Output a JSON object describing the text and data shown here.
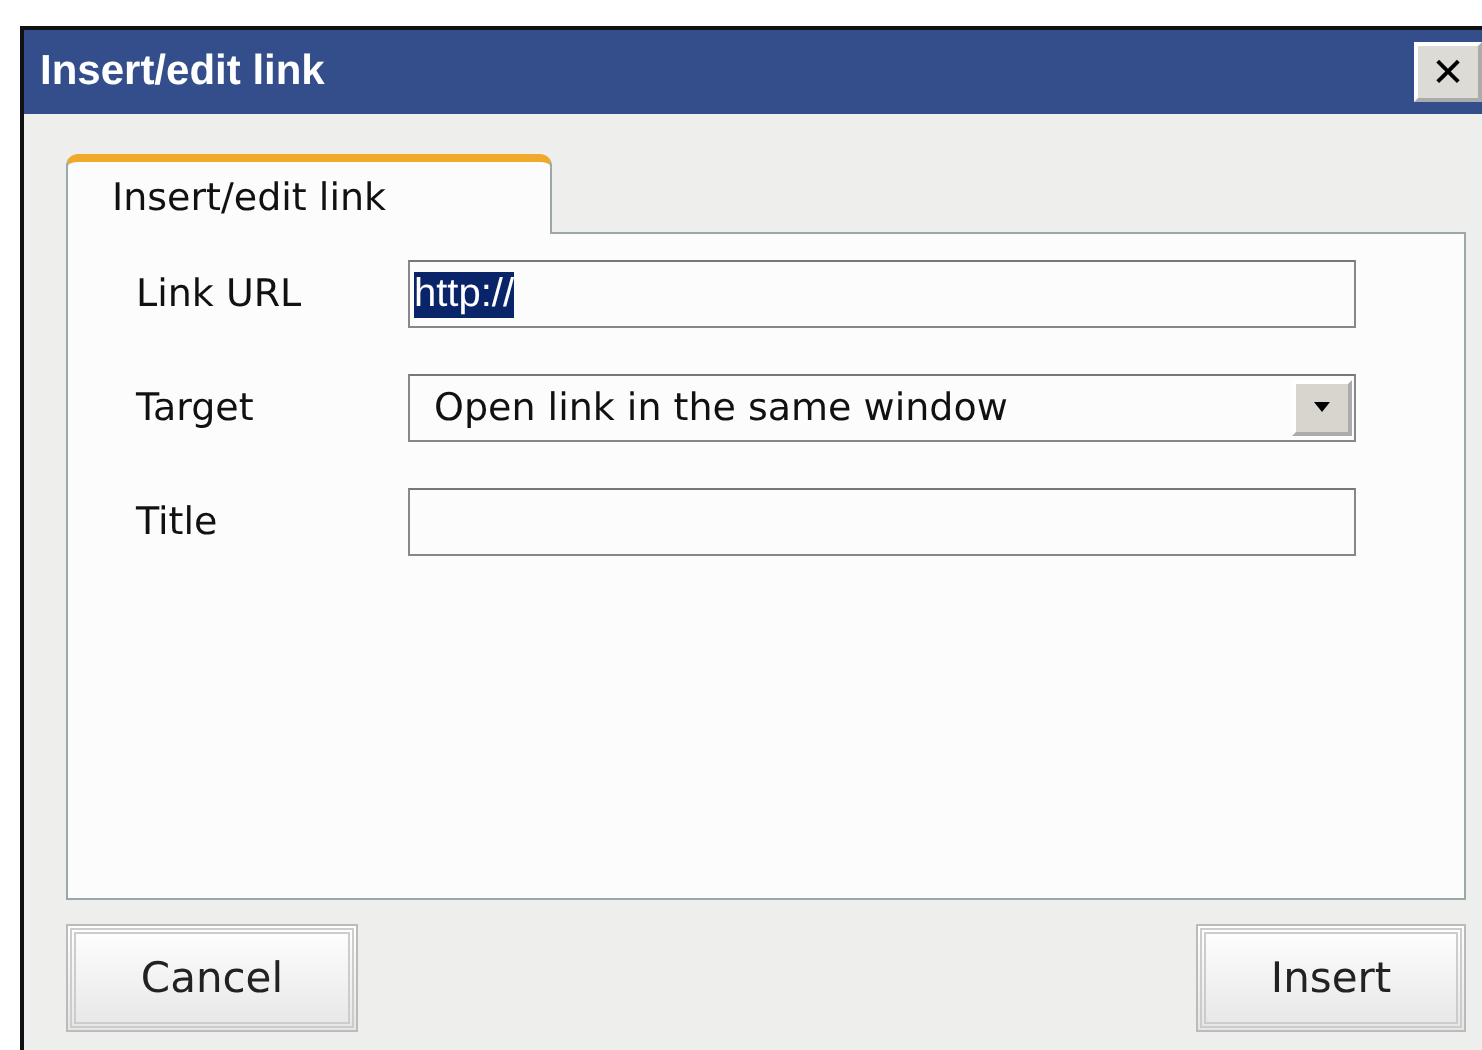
{
  "window": {
    "title": "Insert/edit link",
    "close": "✕"
  },
  "tabs": [
    {
      "label": "Insert/edit link",
      "selected": true
    }
  ],
  "fields": [
    {
      "kind": "text",
      "label": "Link URL",
      "value": "http://",
      "text_selected": true
    },
    {
      "kind": "select",
      "label": "Target",
      "value": "Open link in the same window"
    },
    {
      "kind": "text",
      "label": "Title"
    }
  ],
  "buttons": [
    {
      "label": "Cancel"
    },
    {
      "label": "Insert"
    }
  ]
}
